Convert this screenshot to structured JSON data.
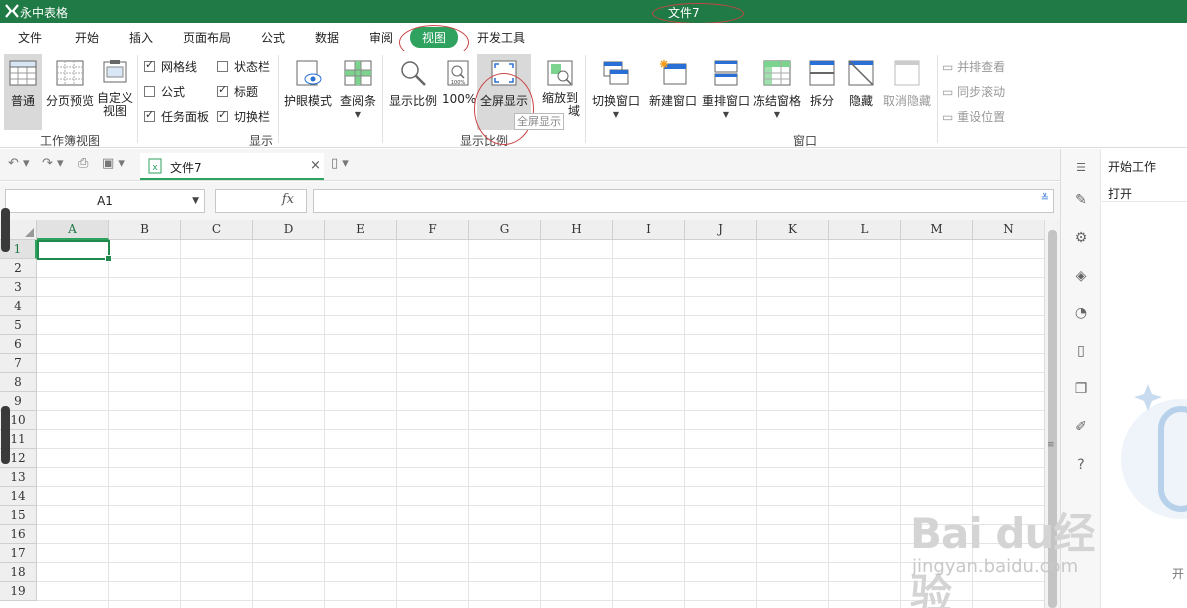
{
  "app": {
    "name": "永中表格",
    "document_title": "文件7"
  },
  "menu": {
    "tabs": [
      "文件",
      "开始",
      "插入",
      "页面布局",
      "公式",
      "数据",
      "审阅",
      "视图",
      "开发工具"
    ],
    "active": "视图"
  },
  "ribbon": {
    "workbook_view": {
      "label": "工作簿视图",
      "normal": "普通",
      "page_break_preview": "分页预览",
      "custom_view_line1": "自定义",
      "custom_view_line2": "视图"
    },
    "show": {
      "label": "显示",
      "gridlines": "网格线",
      "statusbar": "状态栏",
      "formula": "公式",
      "headings": "标题",
      "taskpane": "任务面板",
      "switchbar": "切换栏",
      "checked": {
        "gridlines": true,
        "statusbar": false,
        "formula": false,
        "headings": true,
        "taskpane": true,
        "switchbar": true
      }
    },
    "eye_mode": "护眼模式",
    "reading_bar": "查阅条",
    "zoom": {
      "label": "显示比例",
      "zoom_ratio": "显示比例",
      "hundred": "100%",
      "fullscreen": "全屏显示",
      "zoom_to_line1": "缩放到",
      "zoom_to_suffix": "域",
      "tooltip": "全屏显示"
    },
    "window": {
      "label": "窗口",
      "switch_window": "切换窗口",
      "new_window": "新建窗口",
      "arrange": "重排窗口",
      "freeze": "冻结窗格",
      "split": "拆分",
      "hide": "隐藏",
      "unhide": "取消隐藏",
      "side_by_side": "并排查看",
      "sync_scroll": "同步滚动",
      "reset_position": "重设位置"
    }
  },
  "tabbar": {
    "doc_tab": "文件7",
    "close": "×"
  },
  "formula_bar": {
    "name_box": "A1",
    "fx": "fx",
    "value": ""
  },
  "grid": {
    "columns": [
      "A",
      "B",
      "C",
      "D",
      "E",
      "F",
      "G",
      "H",
      "I",
      "J",
      "K",
      "L",
      "M",
      "N"
    ],
    "rows": [
      "1",
      "2",
      "3",
      "4",
      "5",
      "6",
      "7",
      "8",
      "9",
      "10",
      "11",
      "12",
      "13",
      "14",
      "15",
      "16",
      "17",
      "18",
      "19"
    ],
    "selected_col": "A",
    "selected_row": "1"
  },
  "side_panel": {
    "title": "开始工作",
    "item": "打开",
    "footer": "开",
    "icons": [
      "pencil-icon",
      "sliders-icon",
      "cube-icon",
      "pie-icon",
      "clipboard-icon",
      "copy-icon",
      "edit-icon",
      "help-icon"
    ]
  },
  "watermark": {
    "brand": "Bai du经验",
    "url": "jingyan.baidu.com"
  },
  "colors": {
    "brand": "#1f7a45",
    "accent": "#2fa25f",
    "annotation": "#cc4444"
  }
}
